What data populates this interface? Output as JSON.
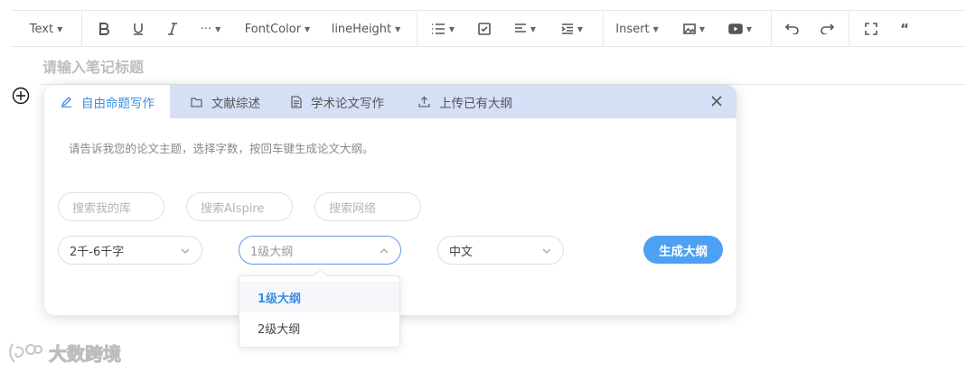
{
  "toolbar": {
    "text_label": "Text",
    "more_label": "···",
    "fontcolor_label": "FontColor",
    "lineheight_label": "lineHeight",
    "insert_label": "Insert",
    "quote_label": "“"
  },
  "editor": {
    "title_placeholder": "请输入笔记标题"
  },
  "panel": {
    "tabs": [
      {
        "label": "自由命题写作",
        "icon": "pencil-icon"
      },
      {
        "label": "文献综述",
        "icon": "folder-icon"
      },
      {
        "label": "学术论文写作",
        "icon": "document-icon"
      },
      {
        "label": "上传已有大纲",
        "icon": "upload-icon"
      }
    ],
    "hint": "请告诉我您的论文主题，选择字数，按回车键生成论文大纲。",
    "search_pills": [
      "搜索我的库",
      "搜索AIspire",
      "搜索网络"
    ],
    "word_count": "2千-6千字",
    "outline_level_placeholder": "1级大纲",
    "language": "中文",
    "generate_label": "生成大纲"
  },
  "dropdown": {
    "options": [
      "1级大纲",
      "2级大纲"
    ],
    "selected": "1级大纲"
  },
  "watermark": {
    "text": "大数跨境"
  },
  "colors": {
    "accent": "#3a8ee6",
    "tab_bar": "#d5dff6",
    "button": "#4ea0f5"
  }
}
